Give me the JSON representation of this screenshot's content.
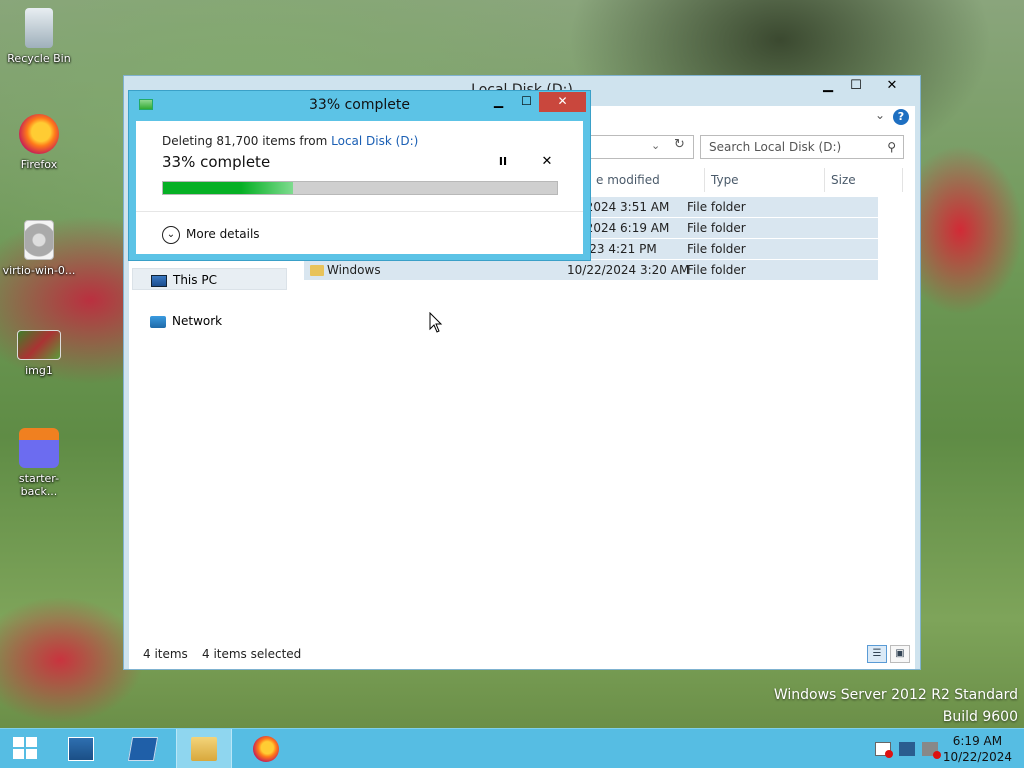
{
  "desktop": {
    "icons": [
      {
        "label": "Recycle Bin",
        "icon": "recycle-bin-icon"
      },
      {
        "label": "Firefox",
        "icon": "firefox-icon"
      },
      {
        "label": "virtio-win-0...",
        "icon": "disc-image-icon"
      },
      {
        "label": "img1",
        "icon": "image-file-icon"
      },
      {
        "label": "starter-back...",
        "icon": "installer-icon"
      }
    ],
    "watermark": {
      "line1": "Windows Server 2012 R2 Standard",
      "line2": "Build 9600"
    }
  },
  "explorer": {
    "title": "Local Disk (D:)",
    "controls": {
      "minimize": "▁",
      "maximize": "☐",
      "close": "✕"
    },
    "help": "?",
    "search_placeholder": "Search Local Disk (D:)",
    "nav": {
      "this_pc": "This PC",
      "network": "Network"
    },
    "columns": {
      "date_modified": "e modified",
      "type": "Type",
      "size": "Size"
    },
    "rows": [
      {
        "name": "",
        "date": "2/2024 3:51 AM",
        "type": "File folder"
      },
      {
        "name": "",
        "date": "2/2024 6:19 AM",
        "type": "File folder"
      },
      {
        "name": "",
        "date": "2023 4:21 PM",
        "type": "File folder"
      },
      {
        "name": "Windows",
        "date": "10/22/2024 3:20 AM",
        "type": "File folder"
      }
    ],
    "status": {
      "items": "4 items",
      "selected": "4 items selected"
    }
  },
  "dialog": {
    "title": "33% complete",
    "deleting_prefix": "Deleting 81,700 items from ",
    "deleting_target": "Local Disk (D:)",
    "percent_label": "33% complete",
    "progress": 0.33,
    "pause": "II",
    "cancel": "✕",
    "more_details": "More details",
    "controls": {
      "minimize": "▁",
      "maximize": "☐",
      "close": "✕"
    }
  },
  "taskbar": {
    "items": [
      "Start",
      "Server Manager",
      "Windows PowerShell",
      "File Explorer",
      "Firefox"
    ],
    "clock": {
      "time": "6:19 AM",
      "date": "10/22/2024"
    }
  },
  "colors": {
    "progress_fill": "#06b025",
    "taskbar": "#56bde3",
    "dialog_frame": "#5cc3e6",
    "close_red": "#c9473d"
  }
}
